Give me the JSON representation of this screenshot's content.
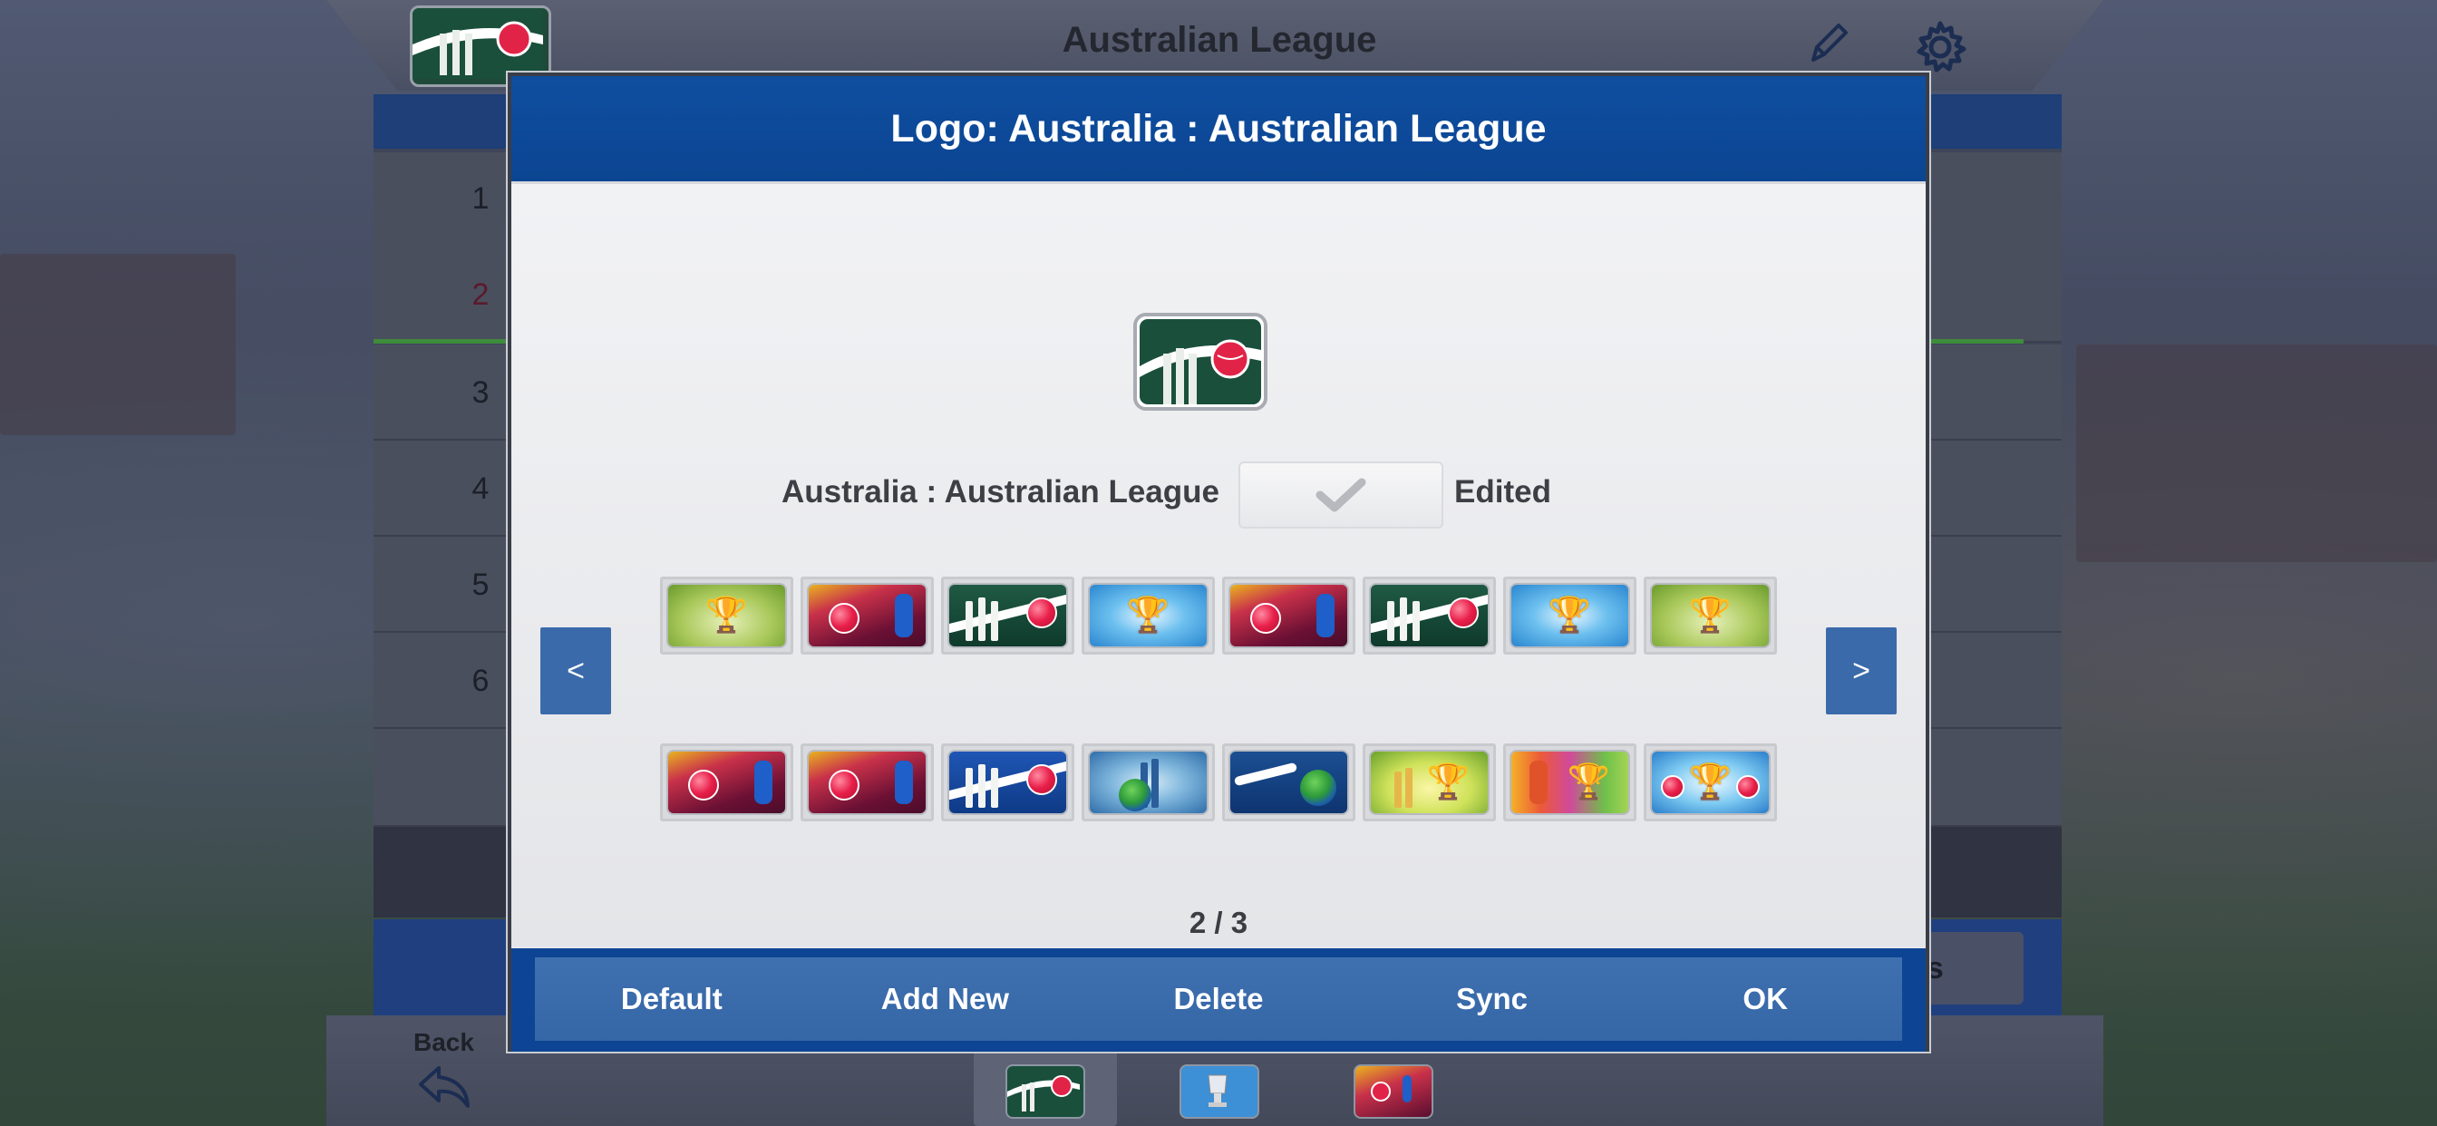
{
  "app": {
    "title": "Australian League",
    "back_label": "Back",
    "bottom_tabs": [
      "",
      "",
      ""
    ],
    "side_button_label": "es",
    "row_numbers": [
      "1",
      "2",
      "3",
      "4",
      "5",
      "6"
    ]
  },
  "modal": {
    "title": "Logo: Australia : Australian League",
    "league_name": "Australia : Australian League",
    "edited_label": "Edited",
    "edited_checked": true,
    "prev_label": "<",
    "next_label": ">",
    "page_indicator": "2 / 3",
    "footer": {
      "default_label": "Default",
      "add_new_label": "Add New",
      "delete_label": "Delete",
      "sync_label": "Sync",
      "ok_label": "OK"
    },
    "logo_rows": [
      [
        "trophy-green",
        "maroon-batsman",
        "green-stumps",
        "blue-trophy",
        "maroon-batsman",
        "green-stumps",
        "blue-trophy",
        "trophy-green"
      ],
      [
        "maroon-batsman",
        "maroon-batsman",
        "blue-stumps",
        "globe-stumps",
        "globe-batsman",
        "yellow-stumps-trophy",
        "rainbow-batsman-trophy",
        "silver-trophy-balls"
      ]
    ]
  },
  "colors": {
    "modal_header": "#0f4ea0",
    "footer": "#3f70b0",
    "nav_button": "#3a6aaa"
  }
}
